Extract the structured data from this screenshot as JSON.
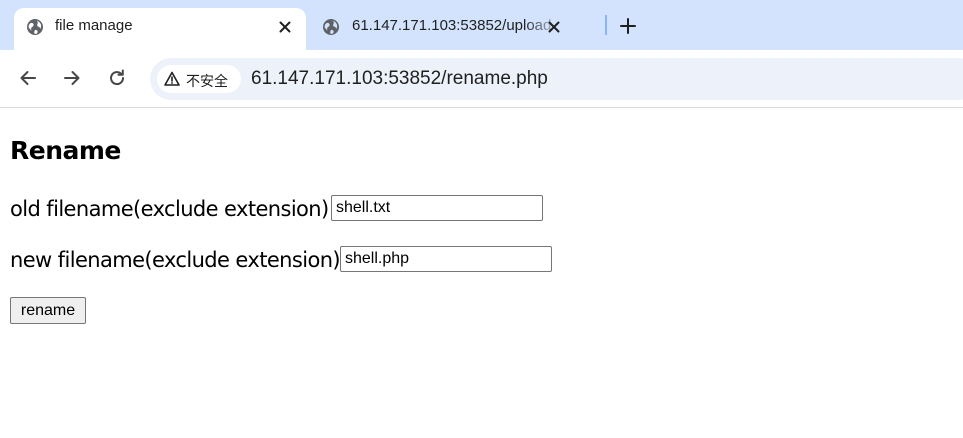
{
  "browser": {
    "tabs": [
      {
        "title": "file manage",
        "active": true,
        "icon": "globe-icon"
      },
      {
        "title": "61.147.171.103:53852/upload",
        "active": false,
        "icon": "globe-icon"
      }
    ],
    "new_tab_icon": "plus-icon",
    "security_label": "不安全",
    "url": "61.147.171.103:53852/rename.php",
    "colors": {
      "tabstrip": "#d3e3fd",
      "omnibox": "#edf2fa"
    }
  },
  "page": {
    "heading": "Rename",
    "form": {
      "old_label": "old filename(exclude extension)：",
      "old_value": "shell.txt",
      "new_label": "new filename(exclude extension)：",
      "new_value": "shell.php",
      "submit_label": "rename"
    }
  }
}
